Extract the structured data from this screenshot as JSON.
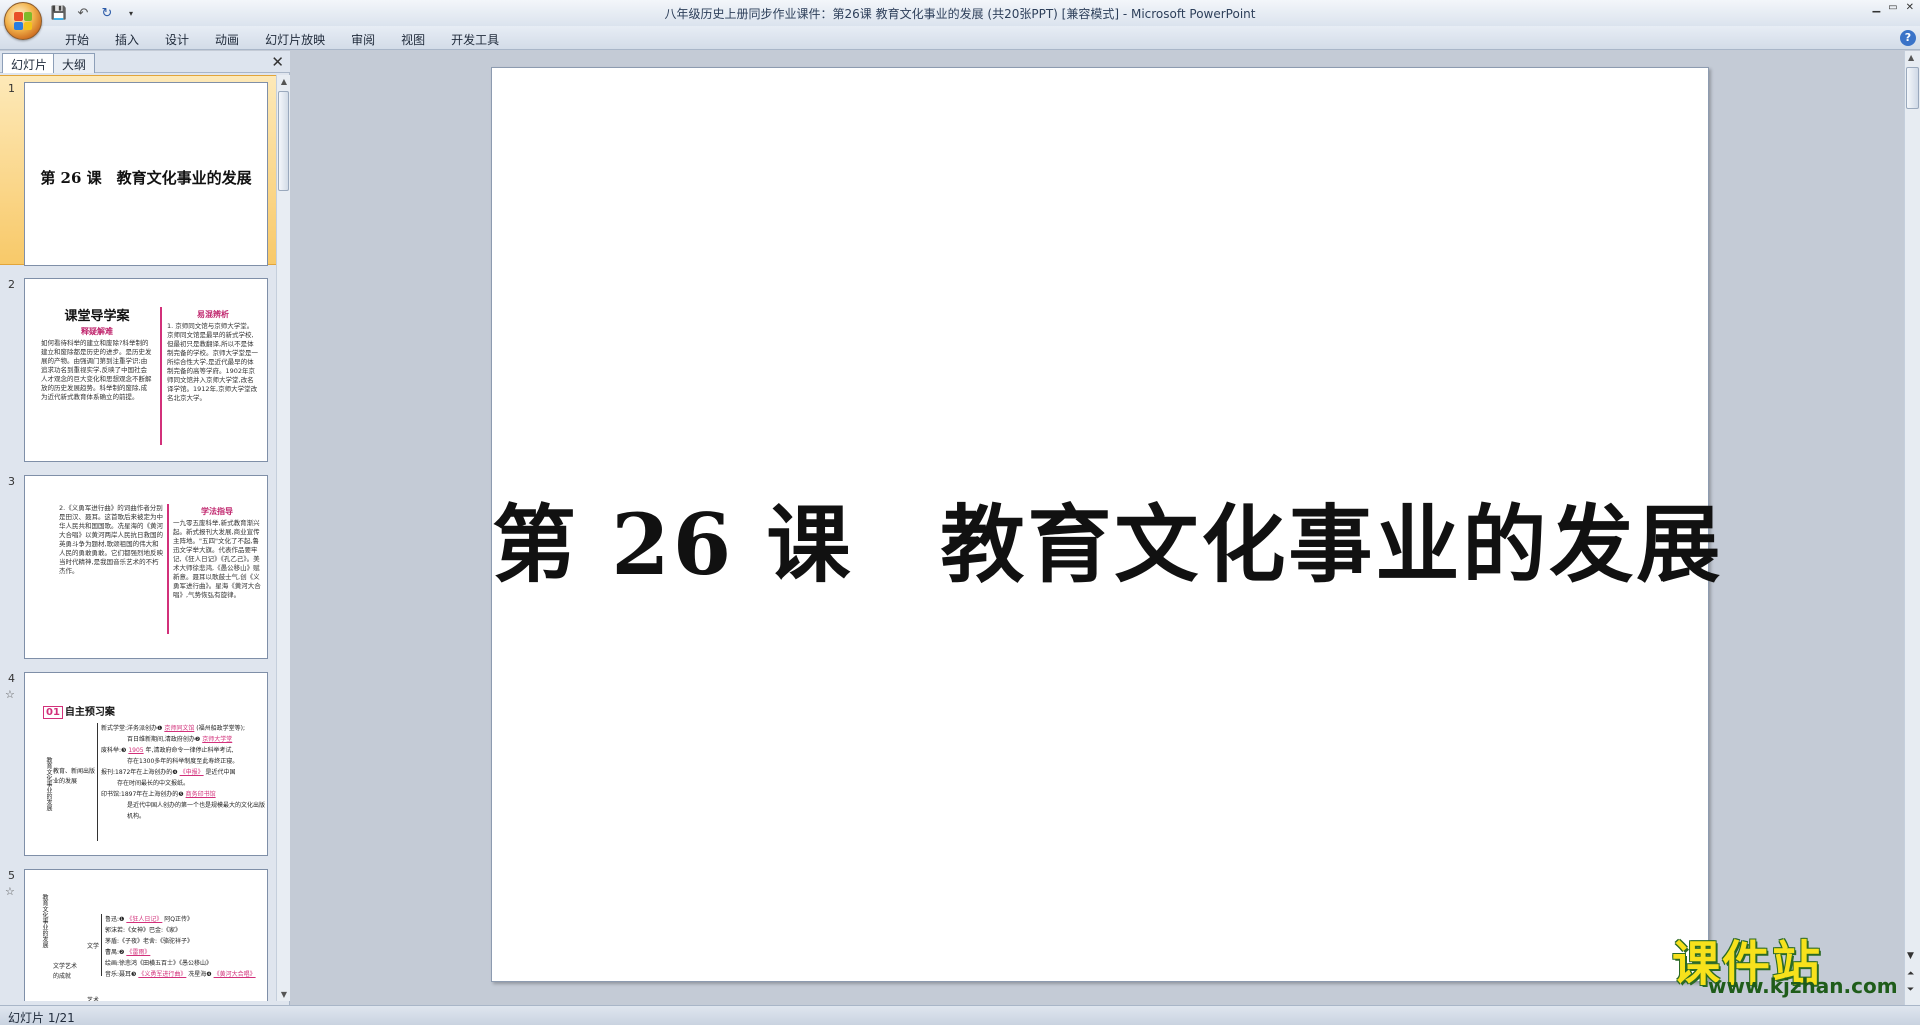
{
  "window": {
    "title": "八年级历史上册同步作业课件：第26课 教育文化事业的发展 (共20张PPT) [兼容模式] - Microsoft PowerPoint"
  },
  "ribbon_tabs": [
    "开始",
    "插入",
    "设计",
    "动画",
    "幻灯片放映",
    "审阅",
    "视图",
    "开发工具"
  ],
  "panel": {
    "tab_slides": "幻灯片",
    "tab_outline": "大纲"
  },
  "thumbnails": [
    {
      "num": "1",
      "title": "第 26 课　教育文化事业的发展"
    },
    {
      "num": "2",
      "head": "课堂导学案",
      "sub_left": "释疑解难",
      "sub_right": "易混辨析",
      "left_text": "如何看待科举的建立和废除?科举制的建立和废除都是历史的进步。是历史发展的产物。由强调门第到注重学识;由追求功名到重视实学,反映了中国社会人才观念的巨大变化和思想观念不断解放的历史发展趋势。科举制的废除,成为近代新式教育体系确立的前提。",
      "right_text": "1. 京师同文馆与京师大学堂。京师同文馆是最早的新式学校,但最初只是教翻译,所以不是体制完备的学校。京师大学堂是一所综合性大学,是近代最早的体制完备的高等学府。1902年京师同文馆并入京师大学堂,改名译学馆。1912年,京师大学堂改名北京大学。"
    },
    {
      "num": "3",
      "sub_right": "学法指导",
      "left_text": "2.《义勇军进行曲》的词曲作者分别是田汉、聂耳。这首歌后来被定为中华人民共和国国歌。冼星海的《黄河大合唱》以黄河两岸人民抗日救国的英勇斗争为题材,歌颂祖国的伟大和人民的勇敢勇敢。它们都强烈地反映当时代精神,是我国音乐艺术的不朽杰作。",
      "right_text": "一九零五废科举,新式教育渐兴起。新式报刊大发展,商业宣传主阵地。\"五四\"文化了不起,鲁迅文学举大旗。代表作品要牢记,《狂人日记》《孔乙己》。美术大师徐悲鸿,《愚公移山》赋新意。聂耳以歌鼓士气,创《义勇军进行曲》。星海《黄河大合唱》,气势恢弘有旋律。"
    },
    {
      "num": "4",
      "badge_num": "01",
      "badge": "自主预习案",
      "side": "教育文化事业的发展",
      "mid": "教育、新闻出版业的发展",
      "lines": [
        "新式学堂:洋务派创办❶",
        "京师同文馆",
        "(福州船政学堂等);",
        "百日维新期间,清政府创办❷",
        "京师大学堂",
        "废科举:❸",
        "1905",
        "年,清政府命令一律停止科举考试,",
        "存在1300多年的科举制度至此寿终正寝。",
        "报刊:1872年在上海创办的❹",
        "《申报》",
        "是近代中国",
        "存在时间最长的中文报纸。",
        "印书馆:1897年在上海创办的❺",
        "商务印书馆",
        "是近代中国人创办的第一个也是规模最大的文化出版机构。"
      ]
    },
    {
      "num": "5",
      "side": "教育文化事业的发展",
      "mid": "文学艺术的成就",
      "lit": "文学",
      "art": "艺术",
      "lines": [
        "鲁迅:❶",
        "《狂人日记》",
        "阿Q正传》",
        "郭沫若:《女神》巴金:《家》",
        "茅盾:《子夜》老舍:《骆驼祥子》",
        "曹禺:❷",
        "《雷雨》",
        "绘画:徐悲鸿《田横五百士》《愚公移山》",
        "音乐:聂耳❸",
        "《义勇军进行曲》",
        "冼星海❹",
        "《黄河大合唱》"
      ]
    }
  ],
  "slide": {
    "title": "第 26 课　教育文化事业的发展"
  },
  "status": {
    "text": "幻灯片 1/21"
  },
  "watermark": {
    "main": "课件站",
    "url": "www.kjzhan.com"
  }
}
